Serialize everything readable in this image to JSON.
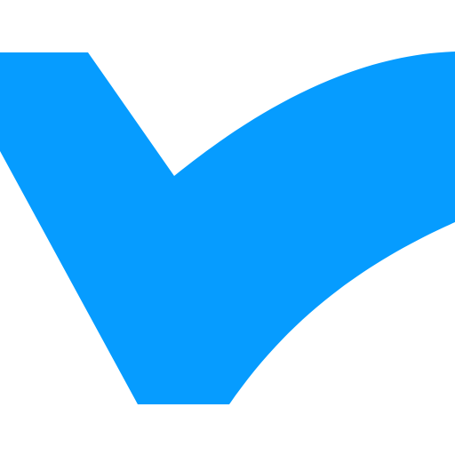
{
  "logo": {
    "icon": "checkmark-icon",
    "color": "#069cff",
    "background": "#ffffff"
  }
}
